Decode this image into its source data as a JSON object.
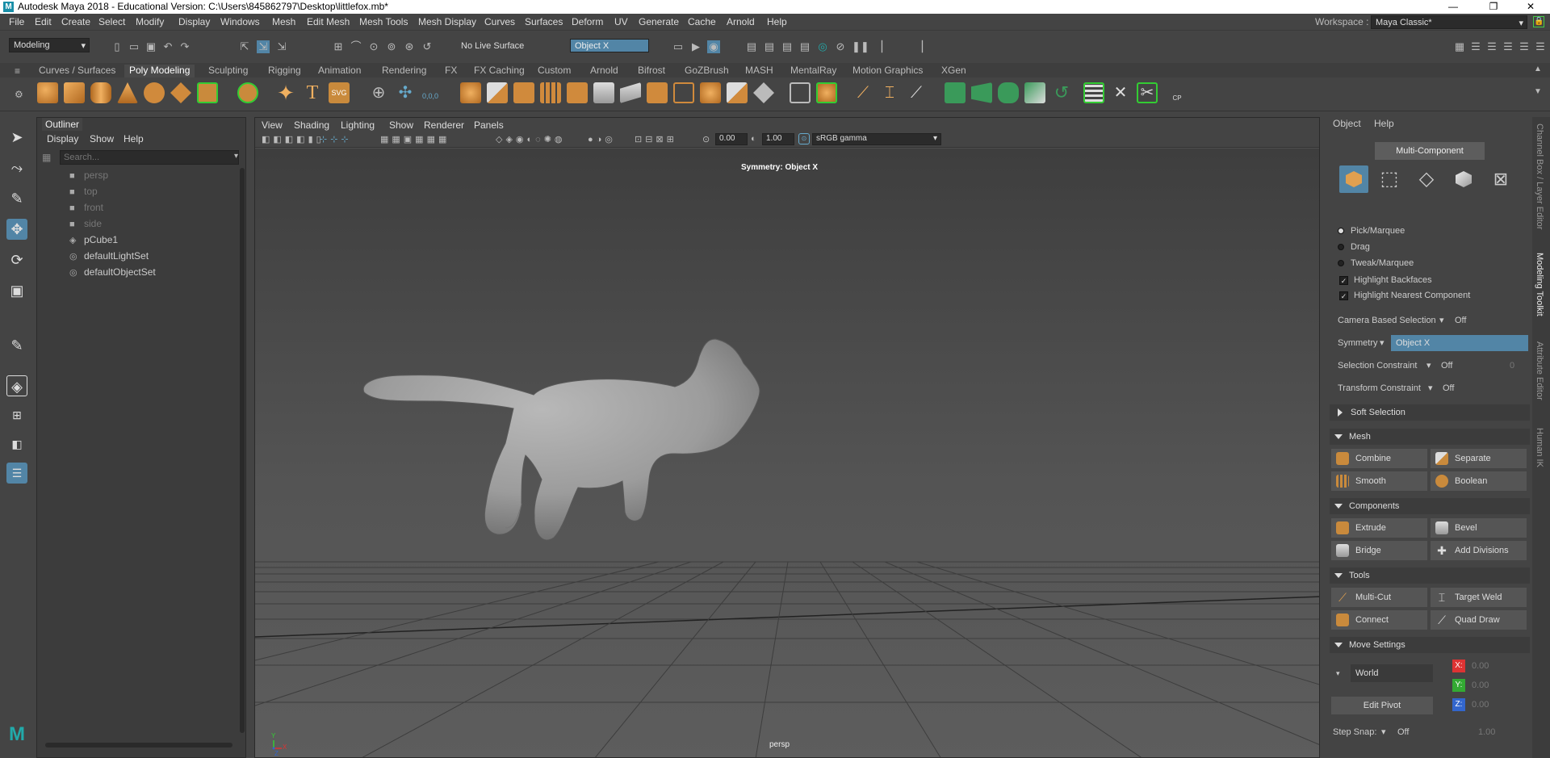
{
  "window": {
    "title": "Autodesk Maya 2018 - Educational Version: C:\\Users\\845862797\\Desktop\\littlefox.mb*",
    "controls": [
      "—",
      "❐",
      "✕"
    ]
  },
  "menubar": [
    "File",
    "Edit",
    "Create",
    "Select",
    "Modify",
    "Display",
    "Windows",
    "Mesh",
    "Edit Mesh",
    "Mesh Tools",
    "Mesh Display",
    "Curves",
    "Surfaces",
    "Deform",
    "UV",
    "Generate",
    "Cache",
    "Arnold",
    "Help"
  ],
  "workspace": {
    "label": "Workspace :",
    "value": "Maya Classic*"
  },
  "toolbar": {
    "mode": "Modeling",
    "live_surface": "No Live Surface",
    "symmetry_field": "Object X"
  },
  "shelf_tabs": [
    "Curves / Surfaces",
    "Poly Modeling",
    "Sculpting",
    "Rigging",
    "Animation",
    "Rendering",
    "FX",
    "FX Caching",
    "Custom",
    "Arnold",
    "Bifrost",
    "GoZBrush",
    "MASH",
    "MentalRay",
    "Motion Graphics",
    "XGen"
  ],
  "shelf_active": "Poly Modeling",
  "shelf_labels": {
    "text_tool": "T",
    "svg_tool": "SVG",
    "cp": "CP",
    "nums": "0,0,0"
  },
  "outliner": {
    "title": "Outliner",
    "menu": [
      "Display",
      "Show",
      "Help"
    ],
    "search_placeholder": "Search...",
    "items": [
      {
        "label": "persp",
        "dim": true
      },
      {
        "label": "top",
        "dim": true
      },
      {
        "label": "front",
        "dim": true
      },
      {
        "label": "side",
        "dim": true
      },
      {
        "label": "pCube1",
        "dim": false
      },
      {
        "label": "defaultLightSet",
        "dim": false
      },
      {
        "label": "defaultObjectSet",
        "dim": false
      }
    ]
  },
  "viewport": {
    "menu": [
      "View",
      "Shading",
      "Lighting",
      "Show",
      "Renderer",
      "Panels"
    ],
    "exposure": "0.00",
    "gamma": "1.00",
    "color_space": "sRGB gamma",
    "symmetry_hud": "Symmetry: Object X",
    "camera_label": "persp",
    "axis_labels": {
      "y": "Y",
      "x": "X",
      "z": "Z"
    }
  },
  "toolkit": {
    "menu": [
      "Object",
      "Help"
    ],
    "mode_button": "Multi-Component",
    "pick_options": [
      "Pick/Marquee",
      "Drag",
      "Tweak/Marquee"
    ],
    "checkboxes": [
      "Highlight Backfaces",
      "Highlight Nearest Component"
    ],
    "camera_based_selection": {
      "label": "Camera Based Selection",
      "value": "Off"
    },
    "symmetry": {
      "label": "Symmetry",
      "value": "Object X"
    },
    "selection_constraint": {
      "label": "Selection Constraint",
      "value": "Off",
      "num": "0"
    },
    "transform_constraint": {
      "label": "Transform Constraint",
      "value": "Off"
    },
    "soft_selection": "Soft Selection",
    "mesh": {
      "header": "Mesh",
      "buttons": [
        "Combine",
        "Separate",
        "Smooth",
        "Boolean"
      ]
    },
    "components": {
      "header": "Components",
      "buttons": [
        "Extrude",
        "Bevel",
        "Bridge",
        "Add Divisions"
      ]
    },
    "tools": {
      "header": "Tools",
      "buttons": [
        "Multi-Cut",
        "Target Weld",
        "Connect",
        "Quad Draw"
      ]
    },
    "move_settings": {
      "header": "Move Settings",
      "space": "World",
      "x": "0.00",
      "y": "0.00",
      "z": "0.00",
      "x_label": "X:",
      "y_label": "Y:",
      "z_label": "Z:",
      "edit_pivot": "Edit Pivot"
    },
    "step_snap": {
      "label": "Step Snap:",
      "value": "Off",
      "num": "1.00"
    }
  },
  "side_tabs": [
    "Channel Box / Layer Editor",
    "Modeling Toolkit",
    "Attribute Editor",
    "Human IK"
  ],
  "colors": {
    "accent": "#5285a6",
    "panel": "#444444",
    "viewport": "#4e4e4e",
    "shelf_orange": "#c98a3c"
  }
}
